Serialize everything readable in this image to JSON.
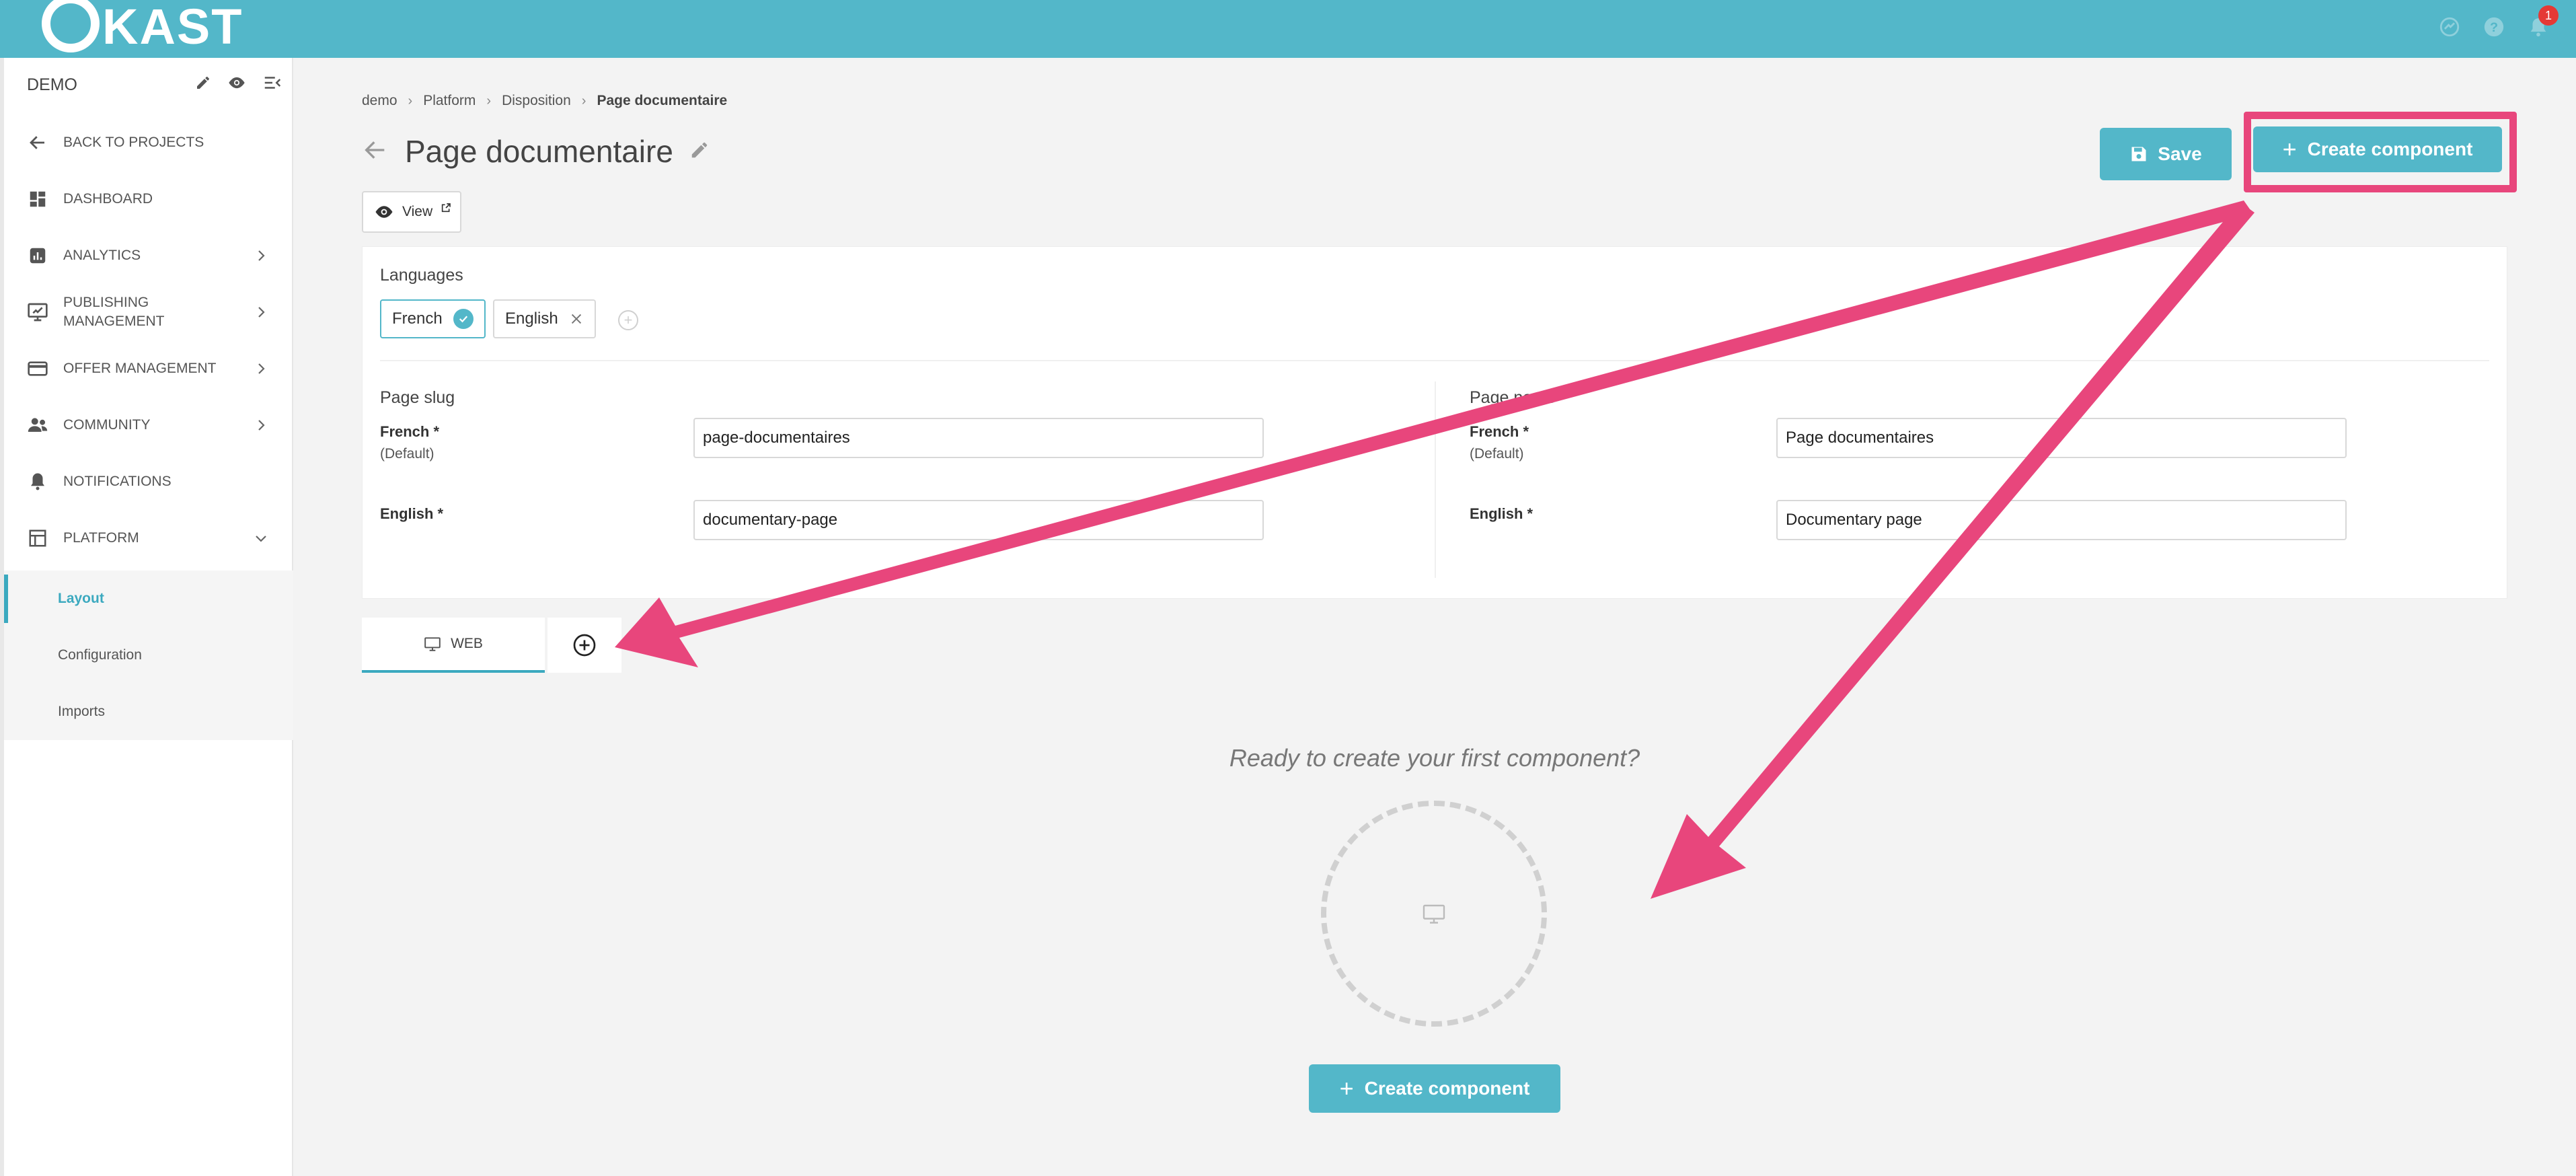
{
  "app": {
    "logo_text": "KAST",
    "notification_count": "1"
  },
  "sidebar": {
    "project": "DEMO",
    "items": [
      {
        "label": "BACK TO PROJECTS"
      },
      {
        "label": "DASHBOARD"
      },
      {
        "label": "ANALYTICS"
      },
      {
        "label": "PUBLISHING MANAGEMENT"
      },
      {
        "label": "OFFER MANAGEMENT"
      },
      {
        "label": "COMMUNITY"
      },
      {
        "label": "NOTIFICATIONS"
      },
      {
        "label": "PLATFORM"
      }
    ],
    "sub_items": [
      {
        "label": "Layout"
      },
      {
        "label": "Configuration"
      },
      {
        "label": "Imports"
      }
    ]
  },
  "breadcrumb": [
    "demo",
    "Platform",
    "Disposition",
    "Page documentaire"
  ],
  "page": {
    "title": "Page documentaire",
    "view_label": "View",
    "save_label": "Save",
    "create_label": "Create component"
  },
  "languages": {
    "label": "Languages",
    "chips": [
      {
        "label": "French",
        "state": "default"
      },
      {
        "label": "English",
        "state": "removable"
      }
    ]
  },
  "slug": {
    "label": "Page slug",
    "french_label": "French *",
    "french_sub": "(Default)",
    "french_value": "page-documentaires",
    "english_label": "English *",
    "english_value": "documentary-page"
  },
  "name": {
    "label": "Page name",
    "french_label": "French *",
    "french_sub": "(Default)",
    "french_value": "Page documentaires",
    "english_label": "English *",
    "english_value": "Documentary page"
  },
  "tabs": [
    {
      "label": "WEB"
    }
  ],
  "empty_state": {
    "text": "Ready to create your first component?",
    "button_label": "Create component"
  },
  "colors": {
    "accent": "#53b7c9",
    "annotation": "#e8467c"
  }
}
